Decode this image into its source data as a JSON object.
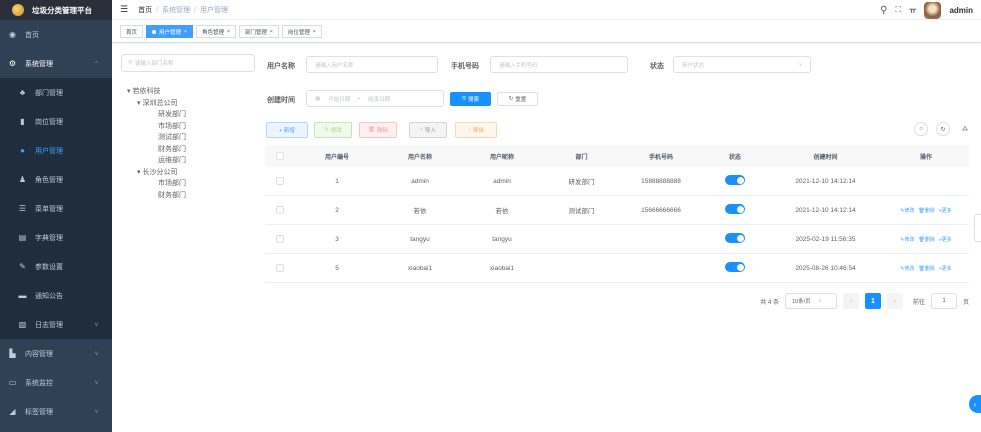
{
  "app": {
    "title": "垃圾分类管理平台"
  },
  "sidebar": {
    "items": [
      {
        "label": "首页",
        "icon": "dashboard-icon"
      },
      {
        "label": "系统管理",
        "icon": "gear-icon",
        "arrow": "^"
      }
    ],
    "sub_items": [
      {
        "label": "部门管理",
        "icon": "tree-icon"
      },
      {
        "label": "岗位管理",
        "icon": "post-icon"
      },
      {
        "label": "用户管理",
        "icon": "user-icon",
        "active": true
      },
      {
        "label": "角色管理",
        "icon": "role-icon"
      },
      {
        "label": "菜单管理",
        "icon": "menu-icon"
      },
      {
        "label": "字典管理",
        "icon": "dict-icon"
      },
      {
        "label": "参数设置",
        "icon": "edit-icon"
      },
      {
        "label": "通知公告",
        "icon": "message-icon"
      },
      {
        "label": "日志管理",
        "icon": "log-icon",
        "arrow": "v"
      }
    ],
    "bottom_items": [
      {
        "label": "内容管理",
        "icon": "document-icon",
        "arrow": "v"
      },
      {
        "label": "系统监控",
        "icon": "monitor-icon",
        "arrow": "v"
      },
      {
        "label": "标签管理",
        "icon": "tag-icon",
        "arrow": "v"
      }
    ]
  },
  "header": {
    "breadcrumb": [
      "首页",
      "系统管理",
      "用户管理"
    ],
    "user": "admin"
  },
  "tags": [
    {
      "label": "首页",
      "closable": false,
      "active": false
    },
    {
      "label": "用户管理",
      "closable": true,
      "active": true
    },
    {
      "label": "角色管理",
      "closable": true,
      "active": false
    },
    {
      "label": "部门管理",
      "closable": true,
      "active": false
    },
    {
      "label": "岗位管理",
      "closable": true,
      "active": false
    }
  ],
  "tree": {
    "search_placeholder": "请输入部门名称",
    "nodes": [
      {
        "label": "▾ 若依科技",
        "level": 0
      },
      {
        "label": "▾ 深圳总公司",
        "level": 1
      },
      {
        "label": "研发部门",
        "level": 2
      },
      {
        "label": "市场部门",
        "level": 2
      },
      {
        "label": "测试部门",
        "level": 2
      },
      {
        "label": "财务部门",
        "level": 2
      },
      {
        "label": "运维部门",
        "level": 2
      },
      {
        "label": "▾ 长沙分公司",
        "level": 1
      },
      {
        "label": "市场部门",
        "level": 2
      },
      {
        "label": "财务部门",
        "level": 2
      }
    ]
  },
  "form": {
    "username_label": "用户名称",
    "username_placeholder": "请输入用户名称",
    "phone_label": "手机号码",
    "phone_placeholder": "请输入手机号码",
    "status_label": "状态",
    "status_placeholder": "用户状态",
    "created_label": "创建时间",
    "start_placeholder": "开始日期",
    "range_sep": "-",
    "end_placeholder": "结束日期",
    "search_btn": "搜索",
    "reset_btn": "重置"
  },
  "toolbar": {
    "add": "+ 新增",
    "edit": "修改",
    "delete": "删除",
    "import": "导入",
    "export": "导出"
  },
  "table": {
    "headers": [
      "用户编号",
      "用户名称",
      "用户昵称",
      "部门",
      "手机号码",
      "状态",
      "创建时间",
      "操作"
    ],
    "rows": [
      {
        "id": "1",
        "name": "admin",
        "nick": "admin",
        "dept": "研发部门",
        "phone": "15888888888",
        "status": true,
        "created": "2021-12-10 14:12:14",
        "ops": false
      },
      {
        "id": "2",
        "name": "若依",
        "nick": "若依",
        "dept": "测试部门",
        "phone": "15666666666",
        "status": true,
        "created": "2021-12-10 14:12:14",
        "ops": true
      },
      {
        "id": "3",
        "name": "tangyu",
        "nick": "tangyu",
        "dept": "",
        "phone": "",
        "status": true,
        "created": "2025-02-19 11:56:35",
        "ops": true
      },
      {
        "id": "5",
        "name": "xiaobai1",
        "nick": "xiaobai1",
        "dept": "",
        "phone": "",
        "status": true,
        "created": "2025-08-26 10:46:54",
        "ops": true
      }
    ],
    "op_edit": "修改",
    "op_delete": "删除",
    "op_more": "更多"
  },
  "pager": {
    "total": "共 4 条",
    "page_size": "10条/页",
    "current": "1",
    "goto_label": "前往",
    "goto_value": "1",
    "page_suffix": "页"
  },
  "colors": {
    "primary": "#1890ff",
    "sidebar_bg": "#304156"
  }
}
